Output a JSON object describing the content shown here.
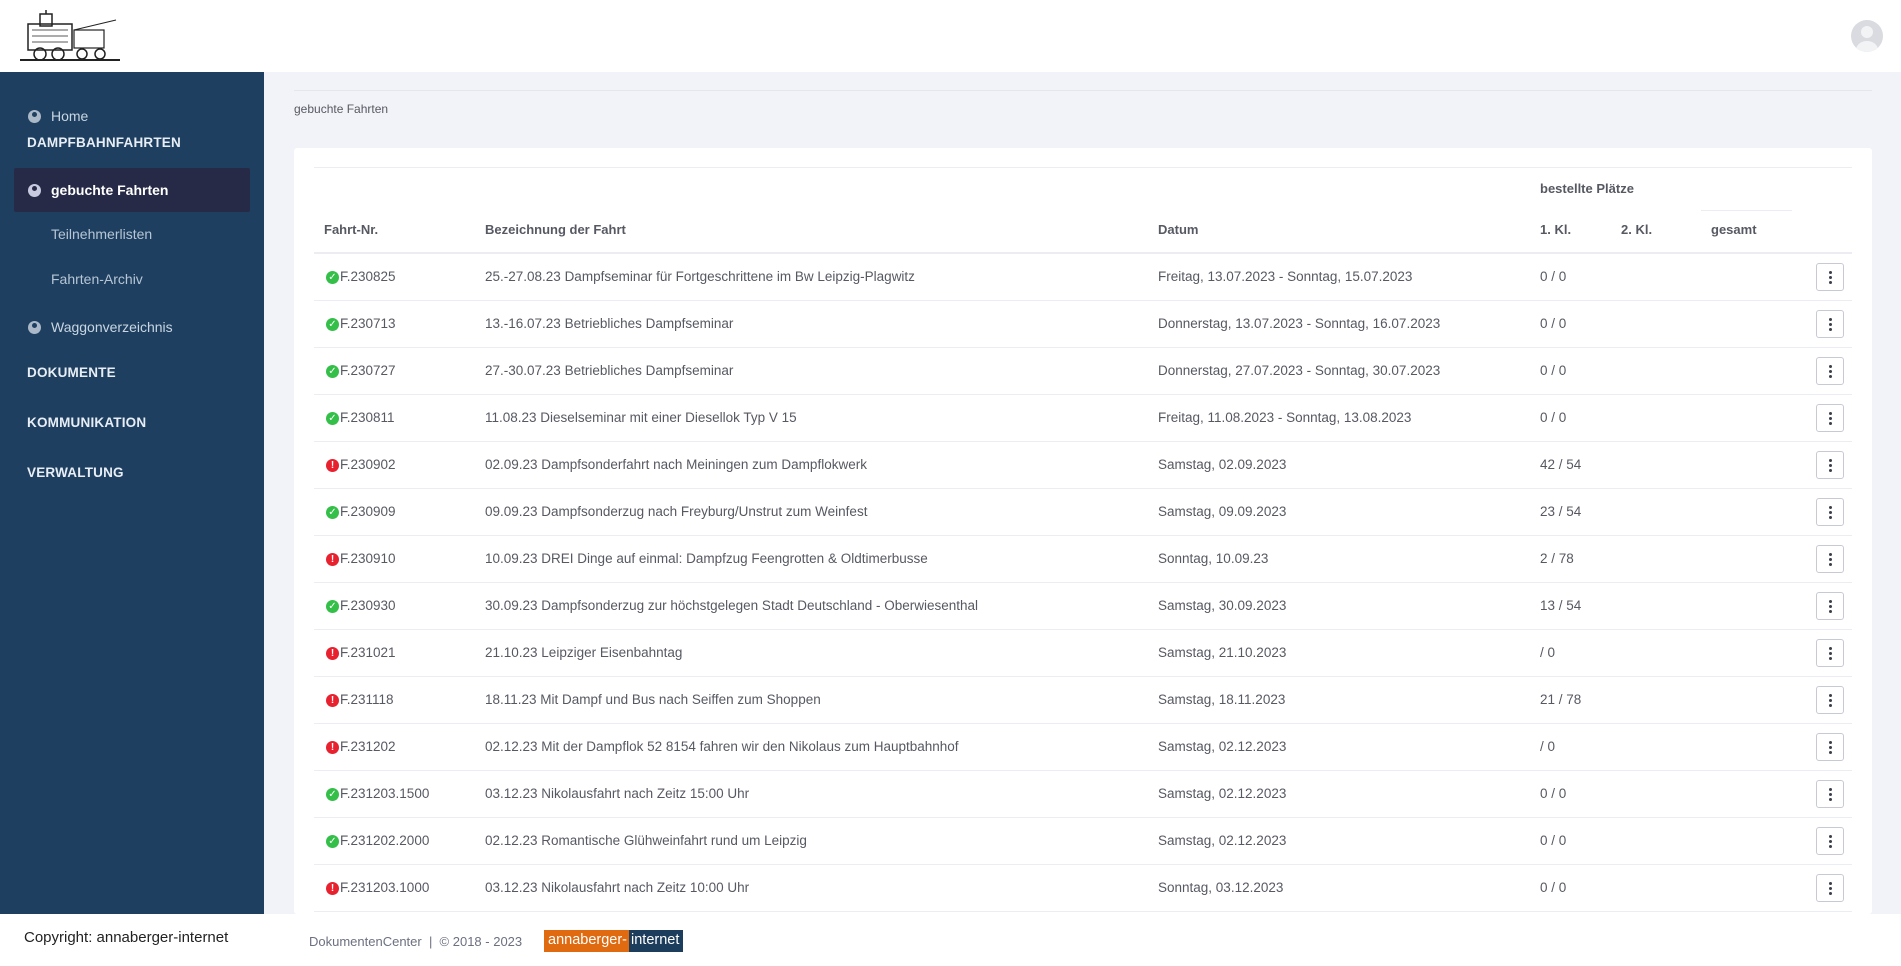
{
  "header": {
    "logo_name": "steam-train-station-logo",
    "avatar_name": "user-avatar"
  },
  "sidebar": {
    "home": "Home",
    "section_dampfbahn": "DAMPFBAHNFAHRTEN",
    "active": "gebuchte Fahrten",
    "sub1": "Teilnehmerlisten",
    "sub2": "Fahrten-Archiv",
    "waggon": "Waggonverzeichnis",
    "section_dokumente": "DOKUMENTE",
    "section_kommunikation": "KOMMUNIKATION",
    "section_verwaltung": "VERWALTUNG"
  },
  "breadcrumb": "gebuchte Fahrten",
  "table": {
    "group_header": "bestellte Plätze",
    "headers": {
      "nr": "Fahrt-Nr.",
      "name": "Bezeichnung der Fahrt",
      "date": "Datum",
      "kl1": "1. Kl.",
      "kl2": "2. Kl.",
      "total": "gesamt"
    },
    "rows": [
      {
        "status": "ok",
        "nr": "F.230825",
        "name": "25.-27.08.23 Dampfseminar für Fortgeschrittene im Bw Leipzig-Plagwitz",
        "date": "Freitag, 13.07.2023 - Sonntag, 15.07.2023",
        "kl1": "0 / 0"
      },
      {
        "status": "ok",
        "nr": "F.230713",
        "name": "13.-16.07.23 Betriebliches Dampfseminar",
        "date": "Donnerstag, 13.07.2023 - Sonntag, 16.07.2023",
        "kl1": "0 / 0"
      },
      {
        "status": "ok",
        "nr": "F.230727",
        "name": "27.-30.07.23 Betriebliches Dampfseminar",
        "date": "Donnerstag, 27.07.2023 - Sonntag, 30.07.2023",
        "kl1": "0 / 0"
      },
      {
        "status": "ok",
        "nr": "F.230811",
        "name": "11.08.23 Dieselseminar mit einer Diesellok Typ V 15",
        "date": "Freitag, 11.08.2023 - Sonntag, 13.08.2023",
        "kl1": "0 / 0"
      },
      {
        "status": "err",
        "nr": "F.230902",
        "name": "02.09.23 Dampfsonderfahrt nach Meiningen zum Dampflokwerk",
        "date": "Samstag, 02.09.2023",
        "kl1": "42 / 54"
      },
      {
        "status": "ok",
        "nr": "F.230909",
        "name": "09.09.23 Dampfsonderzug nach Freyburg/Unstrut zum Weinfest",
        "date": "Samstag, 09.09.2023",
        "kl1": "23 / 54"
      },
      {
        "status": "err",
        "nr": "F.230910",
        "name": "10.09.23 DREI Dinge auf einmal: Dampfzug Feengrotten & Oldtimerbusse",
        "date": "Sonntag, 10.09.23",
        "kl1": "2 / 78"
      },
      {
        "status": "ok",
        "nr": "F.230930",
        "name": "30.09.23 Dampfsonderzug zur höchstgelegen Stadt Deutschland - Oberwiesenthal",
        "date": "Samstag, 30.09.2023",
        "kl1": "13 / 54"
      },
      {
        "status": "err",
        "nr": "F.231021",
        "name": "21.10.23 Leipziger Eisenbahntag",
        "date": "Samstag, 21.10.2023",
        "kl1": "/ 0"
      },
      {
        "status": "err",
        "nr": "F.231118",
        "name": "18.11.23 Mit Dampf und Bus nach Seiffen zum Shoppen",
        "date": "Samstag, 18.11.2023",
        "kl1": "21 / 78"
      },
      {
        "status": "err",
        "nr": "F.231202",
        "name": "02.12.23 Mit der Dampflok 52 8154 fahren wir den Nikolaus zum Hauptbahnhof",
        "date": "Samstag, 02.12.2023",
        "kl1": "/ 0"
      },
      {
        "status": "ok",
        "nr": "F.231203.1500",
        "name": "03.12.23 Nikolausfahrt nach Zeitz 15:00 Uhr",
        "date": "Samstag, 02.12.2023",
        "kl1": "0 / 0"
      },
      {
        "status": "ok",
        "nr": "F.231202.2000",
        "name": "02.12.23 Romantische Glühweinfahrt rund um Leipzig",
        "date": "Samstag, 02.12.2023",
        "kl1": "0 / 0"
      },
      {
        "status": "err",
        "nr": "F.231203.1000",
        "name": "03.12.23 Nikolausfahrt nach Zeitz 10:00 Uhr",
        "date": "Sonntag, 03.12.2023",
        "kl1": "0 / 0"
      }
    ]
  },
  "footer": {
    "copyright": "Copyright: annaberger-internet",
    "app": "DokumentenCenter  |  © 2018 - 2023",
    "brand_a": "annaberger-",
    "brand_b": "internet"
  },
  "colors": {
    "sidebar": "#1e3f5f",
    "active": "#262a47",
    "ok": "#34bf49",
    "err": "#e8212f",
    "brand_orange": "#e06a10"
  }
}
